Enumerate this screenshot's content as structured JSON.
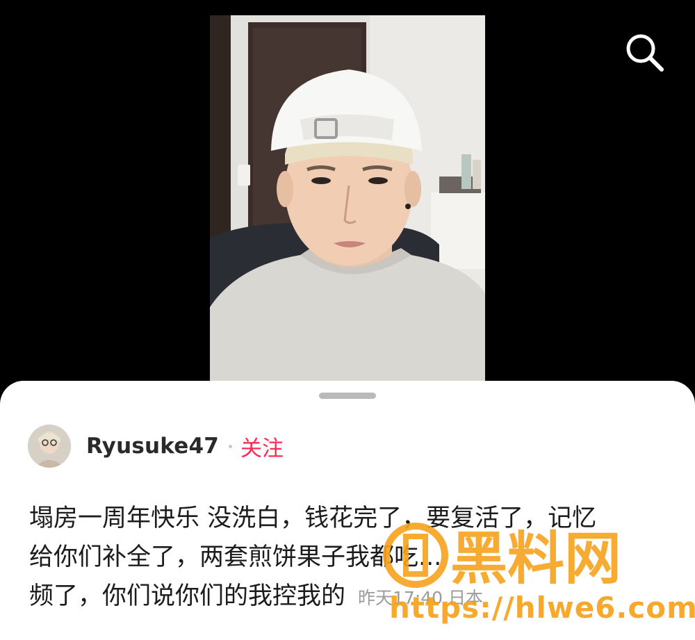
{
  "search": {
    "icon": "search-icon"
  },
  "video": {
    "description_icon": "video-frame"
  },
  "author": {
    "username": "Ryusuke47",
    "follow_label": "关注"
  },
  "caption": {
    "lines": [
      "塌房一周年快乐 没洗白，钱花完了，要复活了，记忆",
      "给你们补全了，两套煎饼果子我都吃...",
      "频了，你们说你们的我控我的"
    ],
    "meta": "昨天17:40 日本"
  },
  "watermark": {
    "logo_text": "黑料网",
    "url": "https://hlwe6.com"
  },
  "colors": {
    "follow": "#fe2c55",
    "watermark": "#f7a21c",
    "sheet": "#ffffff",
    "background": "#000000"
  }
}
